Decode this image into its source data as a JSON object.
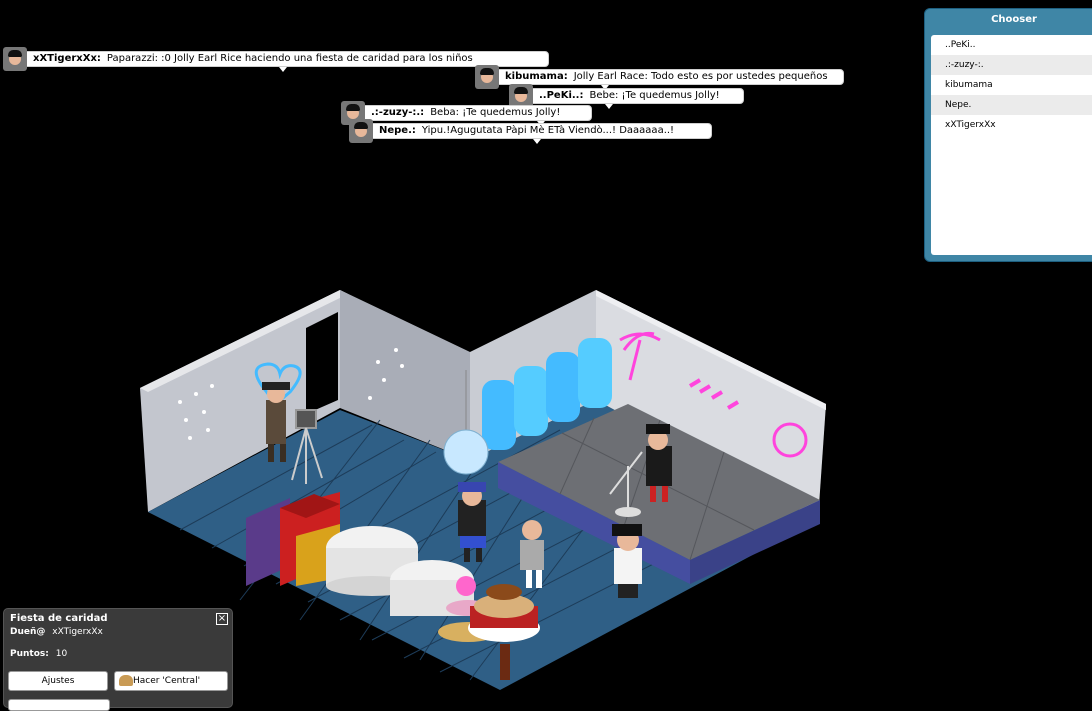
{
  "chat": [
    {
      "user": "xXTigerxXx:",
      "text": "Paparazzi: :0 Jolly Earl Rice haciendo una fiesta de caridad para los niños"
    },
    {
      "user": "kibumama:",
      "text": "Jolly Earl Race: Todo esto es por ustedes pequeños"
    },
    {
      "user": "..PeKi..:",
      "text": "Bebe: ¡Te quedemus Jolly!"
    },
    {
      "user": ".:-zuzy-:.:",
      "text": "Beba: ¡Te quedemus Jolly!"
    },
    {
      "user": "Nepe.:",
      "text": "Yipu.!Agugutata Pàpi Mè ETà Viendò...! Daaaaaa..!"
    }
  ],
  "chooser": {
    "title": "Chooser",
    "users": [
      "..PeKi..",
      ".:-zuzy-:.",
      "kibumama",
      "Nepe.",
      "xXTigerxXx"
    ]
  },
  "room": {
    "name": "Fiesta de caridad",
    "owner_label": "Dueñ@",
    "owner": "xXTigerxXx",
    "points_label": "Puntos:",
    "points": "10",
    "settings_button": "Ajustes",
    "home_button": "Hacer 'Central'",
    "close_icon": "close-icon"
  },
  "colors": {
    "chooser_frame": "#3f86a6",
    "floor": "#2f5f86",
    "wall": "#b9bdc6",
    "stage": "#6d6f74",
    "neon_pink": "#ff44dd",
    "neon_blue": "#44bbff"
  }
}
